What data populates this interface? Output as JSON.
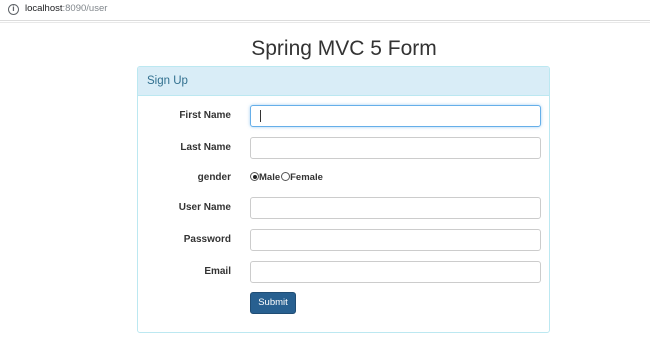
{
  "browser": {
    "url_host": "localhost",
    "url_rest": ":8090/user",
    "info_icon": "info-icon"
  },
  "page": {
    "title": "Spring MVC 5 Form"
  },
  "form": {
    "panel_title": "Sign Up",
    "fields": [
      {
        "label": "First Name",
        "value": "",
        "focused": true
      },
      {
        "label": "Last Name",
        "value": ""
      },
      {
        "label": "gender",
        "options": [
          {
            "label": "Male",
            "checked": true
          },
          {
            "label": "Female",
            "checked": false
          }
        ]
      },
      {
        "label": "User Name",
        "value": ""
      },
      {
        "label": "Password",
        "value": ""
      },
      {
        "label": "Email",
        "value": ""
      }
    ],
    "submit_label": "Submit"
  },
  "colors": {
    "panel_heading_bg": "#d9edf7",
    "panel_heading_text": "#31708f",
    "panel_border": "#bce8f1",
    "primary_button": "#286090",
    "focus_border": "#66afe9"
  }
}
